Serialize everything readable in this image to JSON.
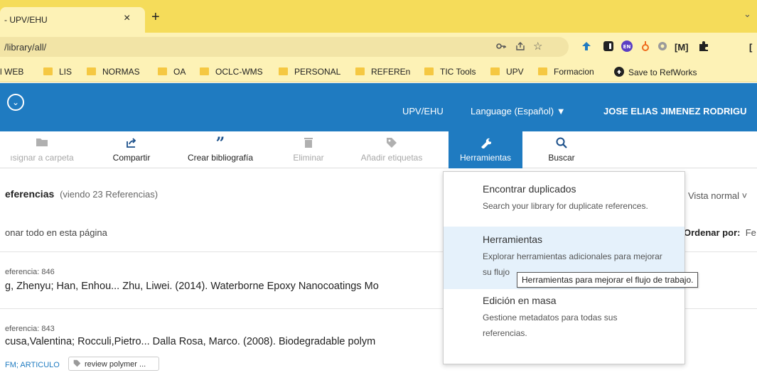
{
  "browser": {
    "tab_title": "- UPV/EHU",
    "tab_close": "×",
    "new_tab": "+",
    "tab_menu": "⌄",
    "url": "/library/all/",
    "ext_doc": "[M]",
    "ext_tail": "[",
    "bookmarks": [
      {
        "label": "l WEB",
        "folder": false
      },
      {
        "label": "LIS",
        "folder": true
      },
      {
        "label": "NORMAS",
        "folder": true
      },
      {
        "label": "OA",
        "folder": true
      },
      {
        "label": "OCLC-WMS",
        "folder": true
      },
      {
        "label": "PERSONAL",
        "folder": true
      },
      {
        "label": "REFEREn",
        "folder": true
      },
      {
        "label": "TIC Tools",
        "folder": true
      },
      {
        "label": "UPV",
        "folder": true
      },
      {
        "label": "Formacion",
        "folder": true
      },
      {
        "label": "Save to RefWorks",
        "folder": false
      }
    ]
  },
  "nav": {
    "chevron": "⌄",
    "org": "UPV/EHU",
    "language": "Language (Español) ▼",
    "user": "JOSE ELIAS JIMENEZ RODRIGU"
  },
  "toolbar": {
    "assign": "ısignar a carpeta",
    "share": "Compartir",
    "bibliography": "Crear bibliografía",
    "delete": "Eliminar",
    "tags": "Añadir etiquetas",
    "tools": "Herramientas",
    "search": "Buscar"
  },
  "refs": {
    "title": "eferencias",
    "count": "(viendo 23 Referencias)",
    "view": "Vista normal ˅",
    "select_all": "onar todo en esta página",
    "sort_label": "Ordenar por:",
    "sort_value": "Fe",
    "items": [
      {
        "id": "eferencia: 846",
        "citation": "g, Zhenyu; Han, Enhou... Zhu, Liwei. (2014). Waterborne Epoxy Nanocoatings Mo"
      },
      {
        "id": "eferencia: 843",
        "citation": "cusa,Valentina; Rocculi,Pietro... Dalla Rosa, Marco. (2008). Biodegradable polym"
      }
    ],
    "folders": "FM; ARTICULO",
    "tag_chip": "review polymer ..."
  },
  "menu": {
    "items": [
      {
        "title": "Encontrar duplicados",
        "desc": "Search your library for duplicate references."
      },
      {
        "title": "Herramientas",
        "desc": "Explorar herramientas adicionales para mejorar",
        "desc2": "su flujo"
      },
      {
        "title": "Edición en masa",
        "desc": "Gestione metadatos para todas sus",
        "desc2": "referencias."
      }
    ],
    "tooltip": "Herramientas para mejorar el flujo de trabajo."
  },
  "colors": {
    "nav_blue": "#1f7bc1",
    "tab_yellow": "#f5dc5a",
    "highlight": "#e5f1fb"
  }
}
